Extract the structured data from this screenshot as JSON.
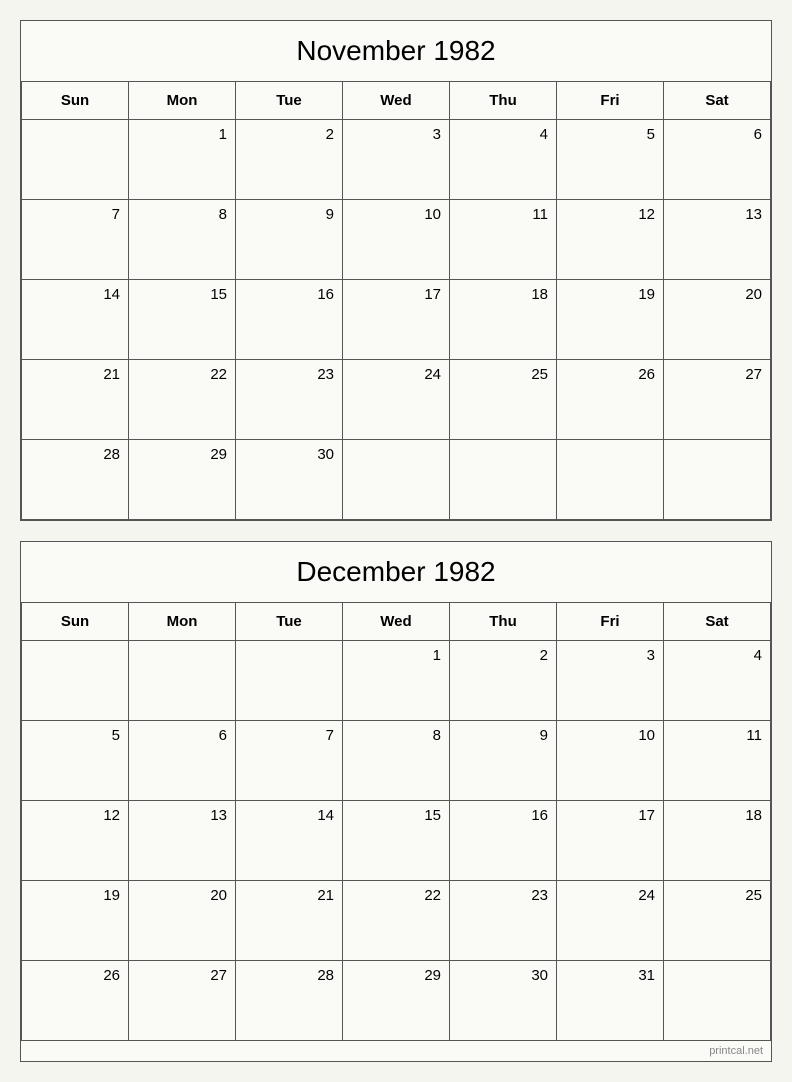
{
  "november": {
    "title": "November 1982",
    "headers": [
      "Sun",
      "Mon",
      "Tue",
      "Wed",
      "Thu",
      "Fri",
      "Sat"
    ],
    "weeks": [
      [
        "",
        "1",
        "2",
        "3",
        "4",
        "5",
        "6"
      ],
      [
        "7",
        "8",
        "9",
        "10",
        "11",
        "12",
        "13"
      ],
      [
        "14",
        "15",
        "16",
        "17",
        "18",
        "19",
        "20"
      ],
      [
        "21",
        "22",
        "23",
        "24",
        "25",
        "26",
        "27"
      ],
      [
        "28",
        "29",
        "30",
        "",
        "",
        "",
        ""
      ]
    ]
  },
  "december": {
    "title": "December 1982",
    "headers": [
      "Sun",
      "Mon",
      "Tue",
      "Wed",
      "Thu",
      "Fri",
      "Sat"
    ],
    "weeks": [
      [
        "",
        "",
        "",
        "1",
        "2",
        "3",
        "4"
      ],
      [
        "5",
        "6",
        "7",
        "8",
        "9",
        "10",
        "11"
      ],
      [
        "12",
        "13",
        "14",
        "15",
        "16",
        "17",
        "18"
      ],
      [
        "19",
        "20",
        "21",
        "22",
        "23",
        "24",
        "25"
      ],
      [
        "26",
        "27",
        "28",
        "29",
        "30",
        "31",
        ""
      ]
    ]
  },
  "watermark": "printcal.net"
}
